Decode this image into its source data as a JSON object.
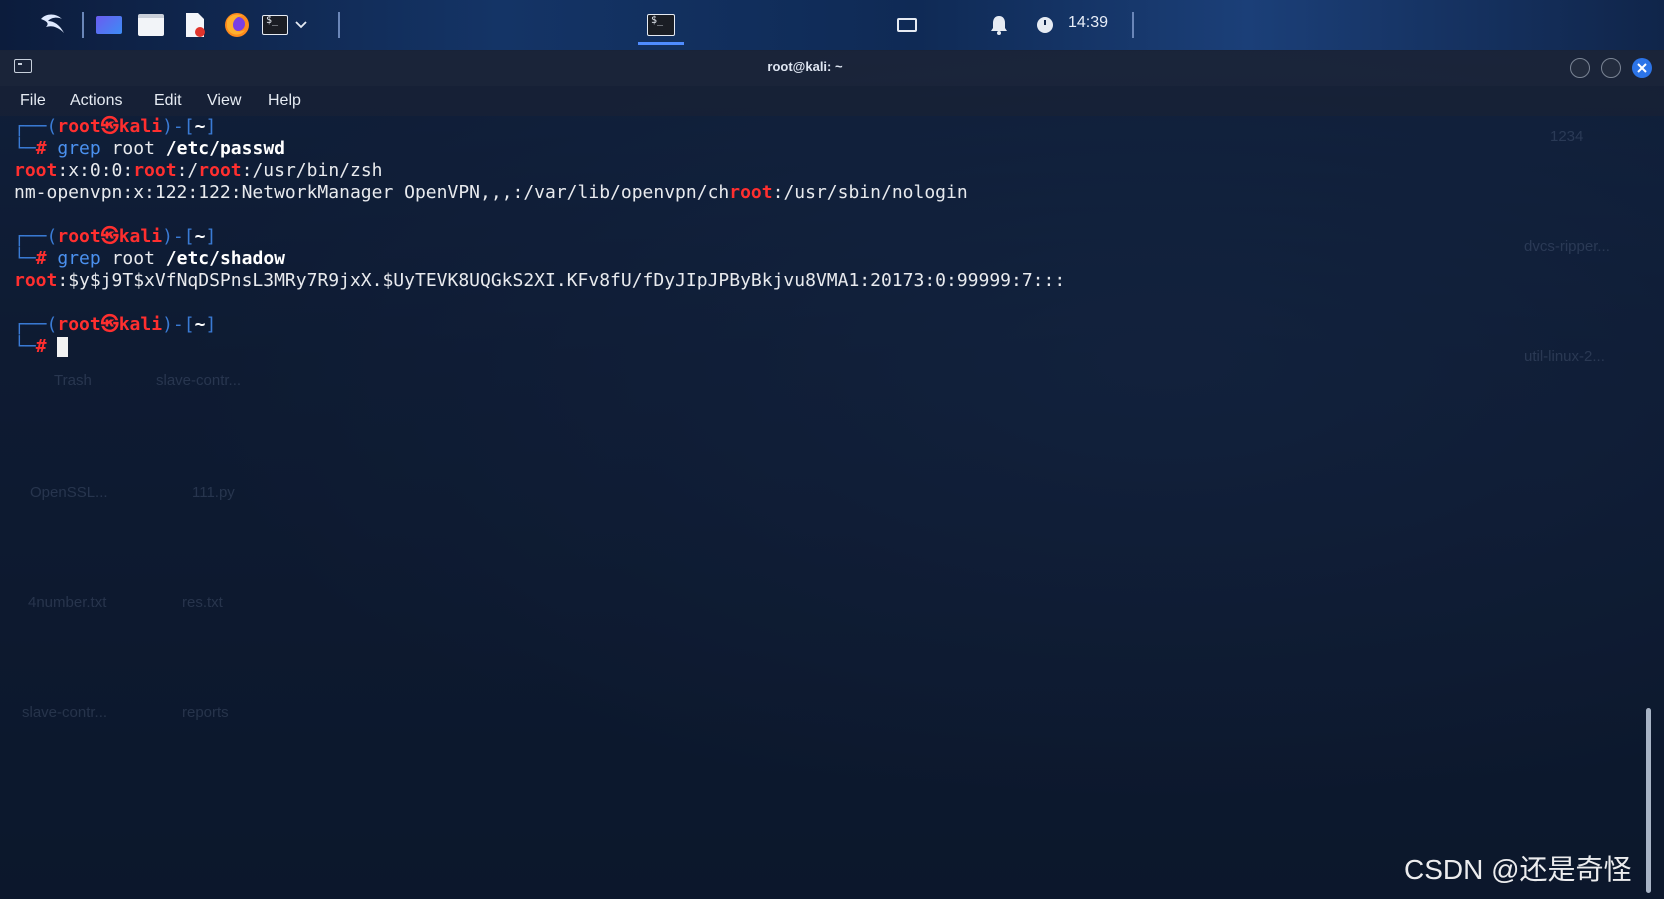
{
  "taskbar": {
    "clock": "14:39",
    "icons": [
      "kali-dragon-icon",
      "workspace-icon",
      "file-manager-icon",
      "text-editor-icon",
      "firefox-icon",
      "terminal-icon",
      "chevron-down-icon",
      "active-terminal-icon",
      "display-icon",
      "bell-icon",
      "power-icon"
    ]
  },
  "window": {
    "title": "root@kali: ~"
  },
  "menu": {
    "file": "File",
    "actions": "Actions",
    "edit": "Edit",
    "view": "View",
    "help": "Help"
  },
  "terminal": {
    "prompt": {
      "corner_top": "┌──(",
      "user": "root",
      "at": "㉿",
      "host": "kali",
      "mid": ")-[",
      "dir": "~",
      "close": "]",
      "corner_bottom": "└─",
      "hash": "#"
    },
    "block1": {
      "cmd_name": "grep",
      "cmd_arg1": "root",
      "cmd_arg2": "/etc/passwd",
      "out1_a": "root",
      "out1_b": ":x:0:0:",
      "out1_c": "root",
      "out1_d": ":/",
      "out1_e": "root",
      "out1_f": ":/usr/bin/zsh",
      "out2_a": "nm-openvpn:x:122:122:NetworkManager OpenVPN,,,:/var/lib/openvpn/ch",
      "out2_b": "root",
      "out2_c": ":/usr/sbin/nologin"
    },
    "block2": {
      "cmd_name": "grep",
      "cmd_arg1": "root",
      "cmd_arg2": "/etc/shadow",
      "out1_a": "root",
      "out1_b": ":$y$j9T$xVfNqDSPnsL3MRy7R9jxX.$UyTEVK8UQGkS2XI.KFv8fU/fDyJIpJPByBkjvu8VMA1:20173:0:99999:7:::"
    }
  },
  "desktop_ghosts": [
    "Trash",
    "slave-contr...",
    "OpenSSL...",
    "111.py",
    "4number.txt",
    "res.txt",
    "slave-contr...",
    "reports",
    "1234",
    "dvcs-ripper...",
    "util-linux-2..."
  ],
  "watermark": "CSDN @还是奇怪",
  "colors": {
    "prompt_blue": "#3a7bd5",
    "prompt_red": "#ff2f2f",
    "close_button": "#2c74e8"
  }
}
